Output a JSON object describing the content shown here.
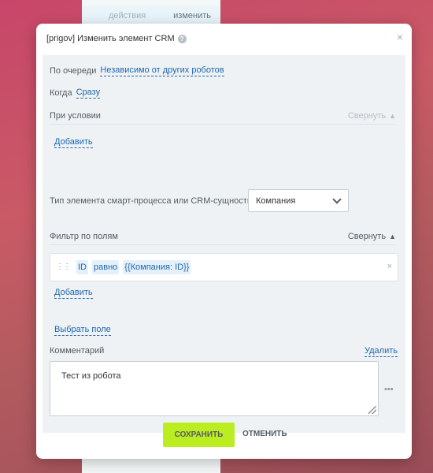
{
  "background": {
    "row_left": "действия",
    "row_right": "изменить"
  },
  "dialog": {
    "title": "[prigov] Изменить элемент CRM",
    "help_icon": "?",
    "close_icon": "×"
  },
  "queue": {
    "label": "По очереди",
    "value": "Независимо от других роботов"
  },
  "when": {
    "label": "Когда",
    "value": "Сразу"
  },
  "condition": {
    "label": "При условии",
    "collapse": "Свернуть",
    "add": "Добавить"
  },
  "element_type": {
    "label": "Тип элемента смарт-процесса или CRM-сущности:",
    "selected": "Компания"
  },
  "filter": {
    "label": "Фильтр по полям",
    "collapse": "Свернуть",
    "field": "ID",
    "operator": "равно",
    "value": "{{Компания: ID}}",
    "remove": "×",
    "add": "Добавить"
  },
  "choose_field": "Выбрать поле",
  "comment": {
    "label": "Комментарий",
    "delete": "Удалить",
    "text": "Тест из робота",
    "more": "•••"
  },
  "buttons": {
    "save": "СОХРАНИТЬ",
    "cancel": "ОТМЕНИТЬ"
  },
  "colors": {
    "save": "#bbed21",
    "link": "#2067b0",
    "panel": "#eef2f4"
  }
}
